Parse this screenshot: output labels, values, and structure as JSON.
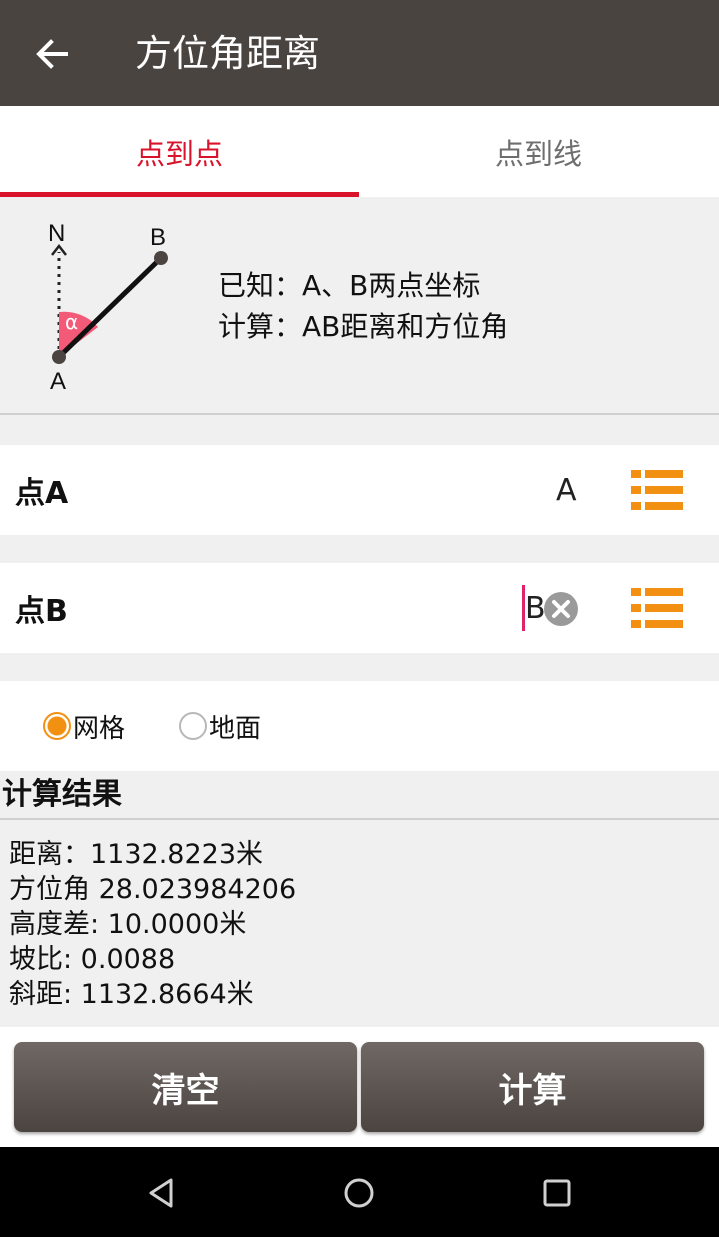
{
  "header": {
    "title": "方位角距离",
    "back_icon": "arrow-left-icon"
  },
  "tabs": [
    {
      "label": "点到点",
      "active": true
    },
    {
      "label": "点到线",
      "active": false
    }
  ],
  "info": {
    "diagram_labels": {
      "north": "N",
      "a": "A",
      "b": "B",
      "alpha": "α"
    },
    "known": "已知：A、B两点坐标",
    "compute": "计算：AB距离和方位角"
  },
  "point_a": {
    "label": "点A",
    "value": "A"
  },
  "point_b": {
    "label": "点B",
    "value": "B"
  },
  "mode": {
    "options": [
      {
        "label": "网格",
        "checked": true
      },
      {
        "label": "地面",
        "checked": false
      }
    ]
  },
  "results": {
    "heading": "计算结果",
    "lines": [
      "距离：1132.8223米",
      "方位角 28.023984206",
      "高度差: 10.0000米",
      "坡比: 0.0088",
      "斜距: 1132.8664米"
    ]
  },
  "actions": {
    "clear_label": "清空",
    "calculate_label": "计算"
  },
  "colors": {
    "accent": "#d9132b",
    "orange": "#f29111",
    "toolbar": "#4a4440"
  }
}
